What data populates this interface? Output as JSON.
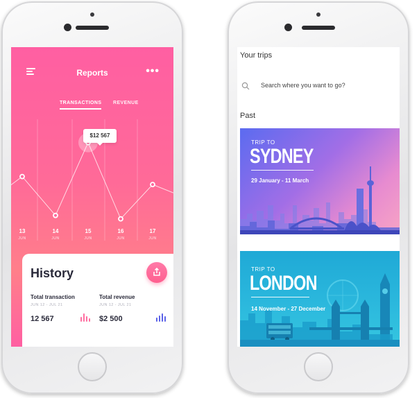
{
  "left_phone": {
    "header": {
      "title": "Reports",
      "menu_icon": "hamburger-icon",
      "more_icon": "more-dots-icon",
      "more_glyph": "•••"
    },
    "tabs": [
      {
        "label": "TRANSACTIONS",
        "active": true
      },
      {
        "label": "REVENUE",
        "active": false
      }
    ],
    "tooltip": {
      "value": "$12 567"
    },
    "chart_data": {
      "type": "line",
      "categories": [
        "13 JUN",
        "14 JUN",
        "15 JUN",
        "16 JUN",
        "17 JUN"
      ],
      "x_ticks": [
        {
          "day": "13",
          "month": "JUN"
        },
        {
          "day": "14",
          "month": "JUN"
        },
        {
          "day": "15",
          "month": "JUN"
        },
        {
          "day": "16",
          "month": "JUN"
        },
        {
          "day": "17",
          "month": "JUN"
        }
      ],
      "series": [
        {
          "values": [
            9600,
            6200,
            12567,
            5900,
            8900
          ]
        }
      ],
      "highlighted_index": 2,
      "ylim": [
        4000,
        14000
      ],
      "grid": "vertical",
      "line_color": "#ffffff"
    },
    "history": {
      "title": "History",
      "share_icon": "share-icon",
      "total_transaction": {
        "label": "Total transaction",
        "period": "JUN 12 - JUL 21",
        "value": "12 567",
        "icon": "bar-chart-icon",
        "color": "#ff6fa1"
      },
      "total_revenue": {
        "label": "Total revenue",
        "period": "JUN 12 - JUL 21",
        "value": "$2 500",
        "icon": "bar-chart-icon",
        "color": "#5c63e8"
      }
    },
    "colors": {
      "gradient_top": "#ff5fa2",
      "gradient_bottom": "#ff7f8a",
      "accent": "#ff5f8f"
    }
  },
  "right_phone": {
    "section_title": "Your trips",
    "search": {
      "placeholder": "Search where you want to go?",
      "icon": "search-icon"
    },
    "past_label": "Past",
    "trips": [
      {
        "pre": "TRIP TO",
        "city": "SYDNEY",
        "dates": "29 January - 11 March",
        "colors": [
          "#5b6bf0",
          "#f7a4c4"
        ]
      },
      {
        "pre": "TRIP TO",
        "city": "LONDON",
        "dates": "14 November - 27 December",
        "colors": [
          "#1fa9d6",
          "#35c6e0"
        ]
      }
    ]
  }
}
